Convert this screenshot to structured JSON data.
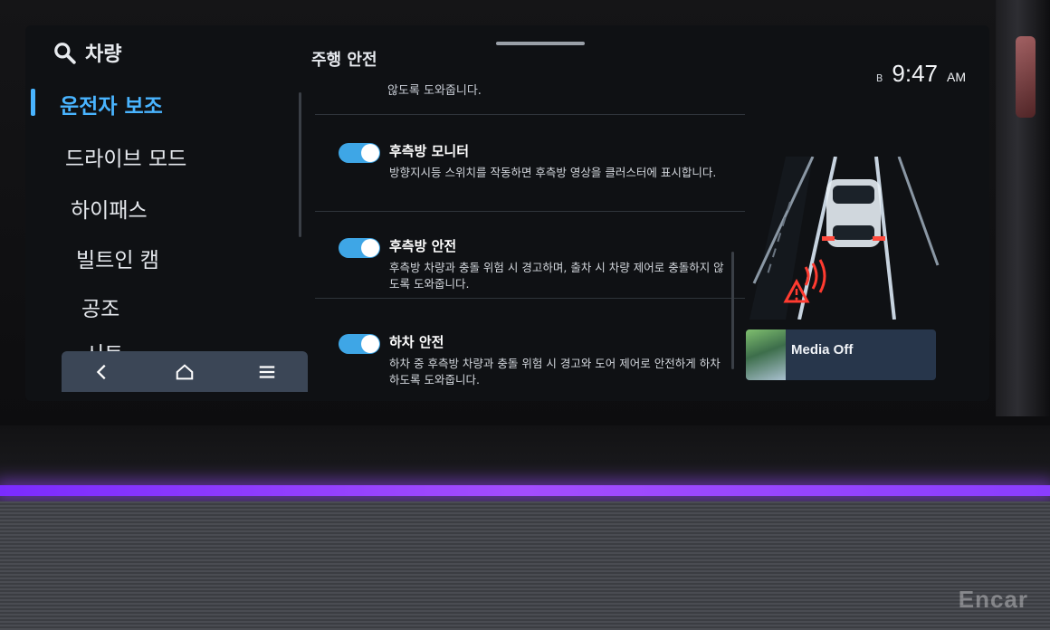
{
  "sidebar": {
    "search_label": "차량",
    "items": [
      {
        "label": "운전자 보조",
        "active": true
      },
      {
        "label": "드라이브 모드",
        "active": false
      },
      {
        "label": "하이패스",
        "active": false
      },
      {
        "label": "빌트인 캠",
        "active": false
      },
      {
        "label": "공조",
        "active": false
      },
      {
        "label": "시트",
        "active": false
      }
    ]
  },
  "navbar": {
    "back_icon": "chevron-left-icon",
    "home_icon": "home-icon",
    "menu_icon": "menu-icon"
  },
  "page": {
    "title": "주행 안전",
    "clipped_text": "않도록 도와줍니다."
  },
  "settings": [
    {
      "title": "후측방 모니터",
      "desc": "방향지시등 스위치를 작동하면 후측방 영상을 클러스터에 표시합니다.",
      "enabled": true
    },
    {
      "title": "후측방 안전",
      "desc": "후측방 차량과 충돌 위험 시 경고하며, 출차 시 차량 제어로 충돌하지 않도록 도와줍니다.",
      "enabled": true
    },
    {
      "title": "하차 안전",
      "desc": "하차 중 후측방 차량과 충돌 위험 시 경고와 도어 제어로 안전하게 하차하도록 도와줍니다.",
      "enabled": true
    }
  ],
  "status": {
    "signal_label": "B",
    "time": "9:47",
    "ampm": "AM"
  },
  "media": {
    "label": "Media Off"
  },
  "watermark": "Encar",
  "colors": {
    "accent": "#49b4ff",
    "toggle_on": "#3ea6e6",
    "ambient_light": "#8a3dff",
    "warning": "#ff3b30"
  }
}
